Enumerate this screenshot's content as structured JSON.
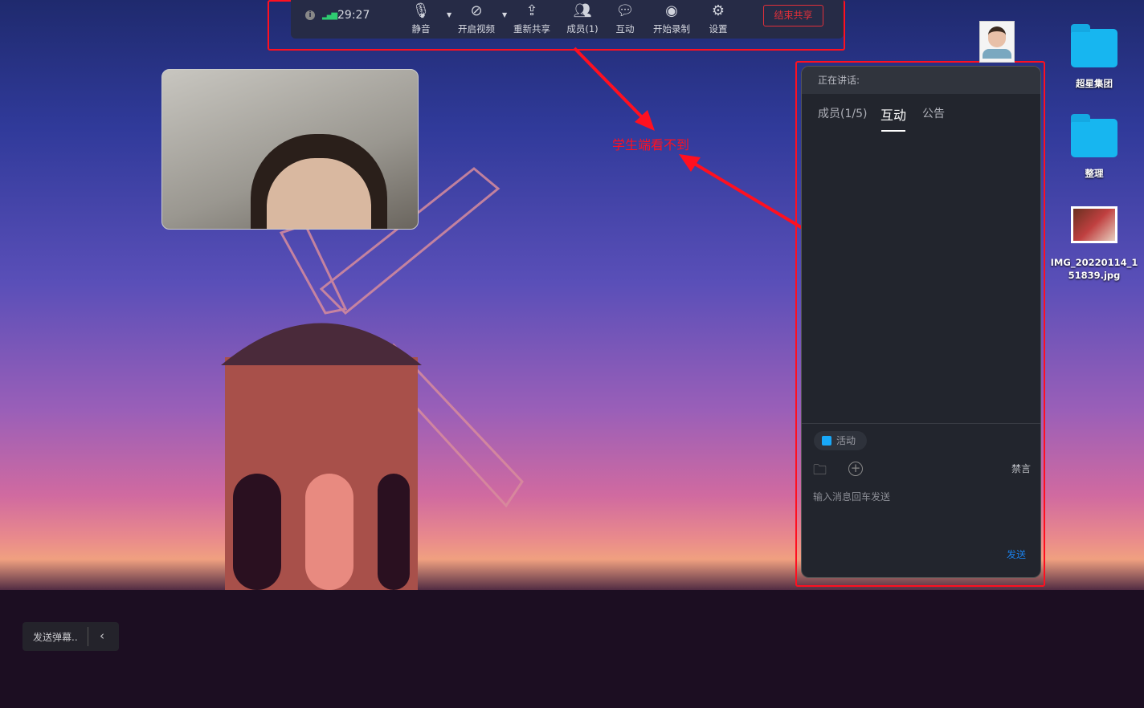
{
  "toolbar": {
    "timer": "29:27",
    "items": [
      {
        "label": "静音",
        "icon": "microphone-icon"
      },
      {
        "label": "开启视频",
        "icon": "video-off-icon"
      },
      {
        "label": "重新共享",
        "icon": "share-screen-icon"
      },
      {
        "label": "成员(1)",
        "icon": "members-icon"
      },
      {
        "label": "互动",
        "icon": "chat-icon"
      },
      {
        "label": "开始录制",
        "icon": "record-icon"
      },
      {
        "label": "设置",
        "icon": "gear-icon"
      }
    ],
    "end_share": "结束共享"
  },
  "annotation": {
    "text": "学生端看不到",
    "color": "#ff1020"
  },
  "panel": {
    "speaking": "正在讲话:",
    "tabs": [
      "成员(1/5)",
      "互动",
      "公告"
    ],
    "active_tab": "互动",
    "activity": "活动",
    "mute_all": "禁言",
    "input_placeholder": "输入消息回车发送",
    "send": "发送"
  },
  "desktop": {
    "icons": [
      "超星集团",
      "整理",
      "IMG_20220114_151839.jpg"
    ]
  },
  "danmaku": {
    "label": "发送弹幕.."
  }
}
